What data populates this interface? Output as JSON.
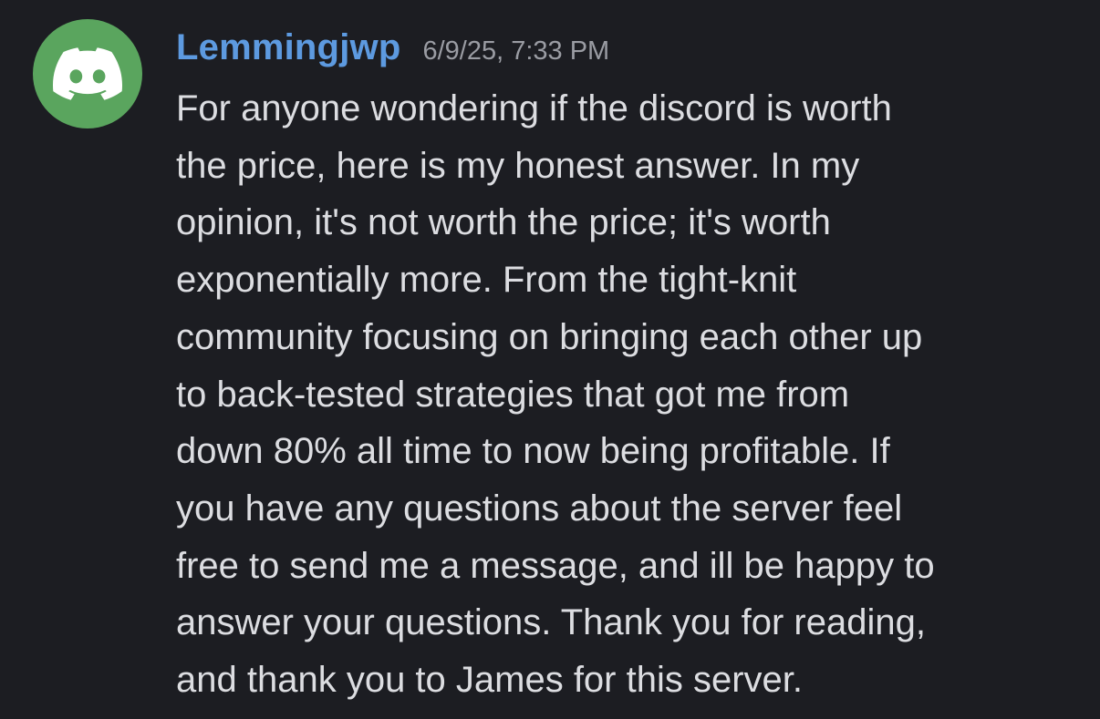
{
  "message": {
    "author": {
      "username": "Lemmingjwp",
      "avatar_icon": "discord-logo-icon",
      "avatar_color": "#5aa55e",
      "username_color": "#5d9ae0"
    },
    "timestamp": "6/9/25, 7:33 PM",
    "lines": [
      "For anyone wondering if the discord is worth",
      "the price, here is my honest answer. In my",
      "opinion, it's not worth the price; it's worth",
      "exponentially more. From the tight-knit",
      "community focusing on bringing each other up",
      "to back-tested strategies that got me from",
      "down 80% all time to now being profitable. If",
      "you have any questions about the server feel",
      "free to send me a message, and ill be happy to",
      "answer your questions. Thank you for reading,",
      "and thank you to James for this server."
    ]
  },
  "theme": {
    "background": "#1c1d22",
    "text_color": "#dcdde1",
    "timestamp_color": "#9a9ca3"
  }
}
